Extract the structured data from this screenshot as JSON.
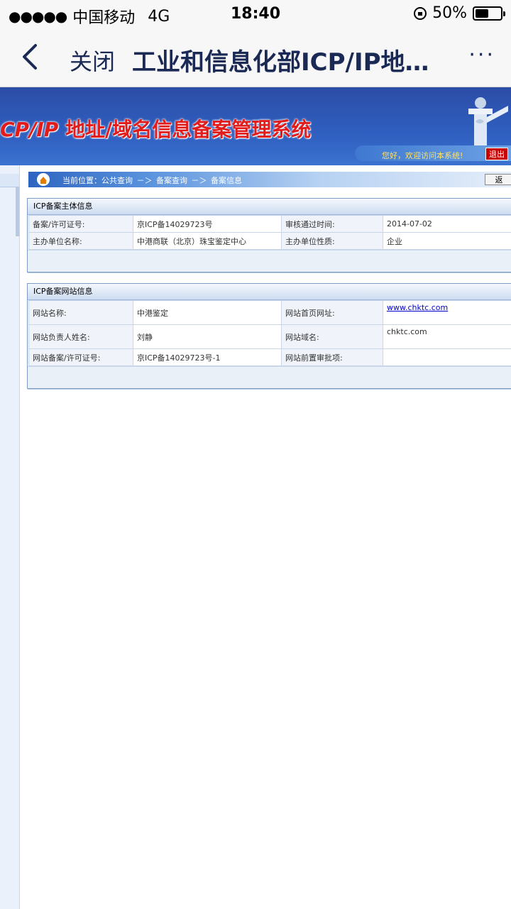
{
  "status_bar": {
    "signal": "●●●●●",
    "carrier": "中国移动",
    "network": "4G",
    "time": "18:40",
    "battery": "50%"
  },
  "nav": {
    "close_label": "关闭",
    "title": "工业和信息化部ICP/IP地…",
    "more": "···"
  },
  "banner": {
    "title_prefix": "CP/IP",
    "title_rest": " 地址/域名信息备案管理系统",
    "welcome": "您好，欢迎访问本系统!",
    "logout": "退出"
  },
  "breadcrumb": {
    "text": "当前位置：公共查询 －＞ 备案查询 －＞ 备案信息",
    "return_label": "返"
  },
  "subject_panel": {
    "title": "ICP备案主体信息",
    "rows": [
      {
        "label1": "备案/许可证号:",
        "value1": "京ICP备14029723号",
        "label2": "审核通过时间:",
        "value2": "2014-07-02"
      },
      {
        "label1": "主办单位名称:",
        "value1": "中港商联（北京）珠宝鉴定中心",
        "label2": "主办单位性质:",
        "value2": "企业"
      }
    ]
  },
  "site_panel": {
    "title": "ICP备案网站信息",
    "rows": [
      {
        "label1": "网站名称:",
        "value1": "中港鉴定",
        "label2": "网站首页网址:",
        "value2": "www.chktc.com"
      },
      {
        "label1": "网站负责人姓名:",
        "value1": "刘静",
        "label2": "网站域名:",
        "value2": "chktc.com"
      },
      {
        "label1": "网站备案/许可证号:",
        "value1": "京ICP备14029723号-1",
        "label2": "网站前置审批项:",
        "value2": ""
      }
    ]
  }
}
